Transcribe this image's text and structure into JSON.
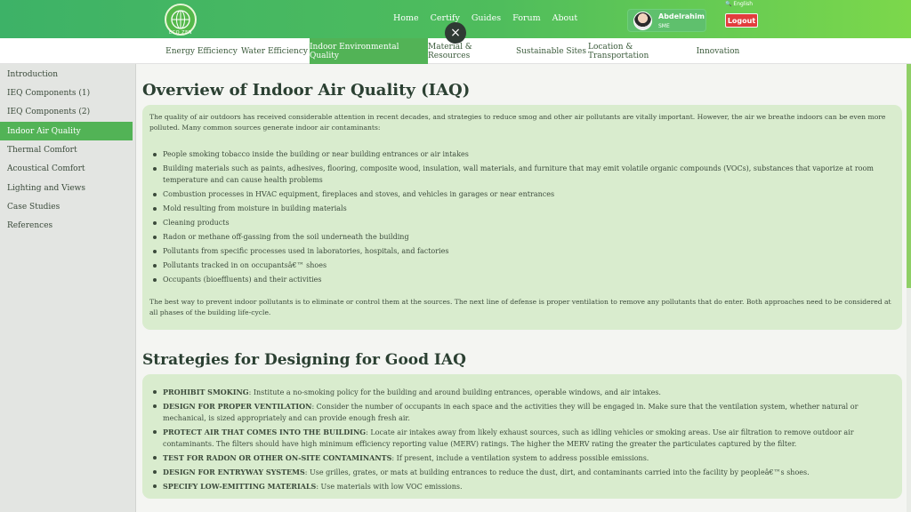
{
  "header": {
    "logo_text": "ECO ZEN",
    "nav": [
      "Home",
      "Certify",
      "Guides",
      "Forum",
      "About"
    ],
    "user": {
      "name": "Abdelrahim",
      "role": "SME"
    },
    "language": "English",
    "logout_label": "Logout",
    "close_label": "×"
  },
  "tabs": [
    {
      "label": "Energy Efficiency",
      "active": false
    },
    {
      "label": "Water Efficiency",
      "active": false
    },
    {
      "label": "Indoor Environmental Quality",
      "active": true
    },
    {
      "label": "Material & Resources",
      "active": false
    },
    {
      "label": "Sustainable Sites",
      "active": false
    },
    {
      "label": "Location & Transportation",
      "active": false
    },
    {
      "label": "Innovation",
      "active": false
    }
  ],
  "sidebar": {
    "items": [
      {
        "label": "Introduction",
        "active": false
      },
      {
        "label": "IEQ Components (1)",
        "active": false
      },
      {
        "label": "IEQ Components (2)",
        "active": false
      },
      {
        "label": "Indoor Air Quality",
        "active": true
      },
      {
        "label": "Thermal Comfort",
        "active": false
      },
      {
        "label": "Acoustical Comfort",
        "active": false
      },
      {
        "label": "Lighting and Views",
        "active": false
      },
      {
        "label": "Case Studies",
        "active": false
      },
      {
        "label": "References",
        "active": false
      }
    ]
  },
  "section1": {
    "title": "Overview of Indoor Air Quality (IAQ)",
    "intro": "The quality of air outdoors has received considerable attention in recent decades, and strategies to reduce smog and other air pollutants are vitally important. However, the air we breathe indoors can be even more polluted. Many common sources generate indoor air contaminants:",
    "bullets": [
      "People smoking tobacco inside the building or near building entrances or air intakes",
      "Building materials such as paints, adhesives, flooring, composite wood, insulation, wall materials, and furniture that may emit volatile organic compounds (VOCs), substances that vaporize at room temperature and can cause health problems",
      "Combustion processes in HVAC equipment, fireplaces and stoves, and vehicles in garages or near entrances",
      "Mold resulting from moisture in building materials",
      "Cleaning products",
      "Radon or methane off-gassing from the soil underneath the building",
      "Pollutants from specific processes used in laboratories, hospitals, and factories",
      "Pollutants tracked in on occupantsâ€™ shoes",
      "Occupants (bioeffluents) and their activities"
    ],
    "closing": "The best way to prevent indoor pollutants is to eliminate or control them at the sources. The next line of defense is proper ventilation to remove any pollutants that do enter. Both approaches need to be considered at all phases of the building life-cycle."
  },
  "section2": {
    "title": "Strategies for Designing for Good IAQ",
    "items": [
      {
        "term": "PROHIBIT SMOKING",
        "text": ": Institute a no-smoking policy for the building and around building entrances, operable windows, and air intakes."
      },
      {
        "term": "DESIGN FOR PROPER VENTILATION",
        "text": ": Consider the number of occupants in each space and the activities they will be engaged in. Make sure that the ventilation system, whether natural or mechanical, is sized appropriately and can provide enough fresh air."
      },
      {
        "term": "PROTECT AIR THAT COMES INTO THE BUILDING",
        "text": ": Locate air intakes away from likely exhaust sources, such as idling vehicles or smoking areas. Use air filtration to remove outdoor air contaminants. The filters should have high minimum efficiency reporting value (MERV) ratings. The higher the MERV rating the greater the particulates captured by the filter."
      },
      {
        "term": "TEST FOR RADON OR OTHER ON-SITE CONTAMINANTS",
        "text": ": If present, include a ventilation system to address possible emissions."
      },
      {
        "term": "DESIGN FOR ENTRYWAY SYSTEMS",
        "text": ": Use grilles, grates, or mats at building entrances to reduce the dust, dirt, and contaminants carried into the facility by peopleâ€™s shoes."
      },
      {
        "term": "SPECIFY LOW-EMITTING MATERIALS",
        "text": ": Use materials with low VOC emissions."
      }
    ]
  },
  "colors": {
    "accent": "#52b356",
    "card": "#d9ecce",
    "logout": "#e23d3d"
  }
}
